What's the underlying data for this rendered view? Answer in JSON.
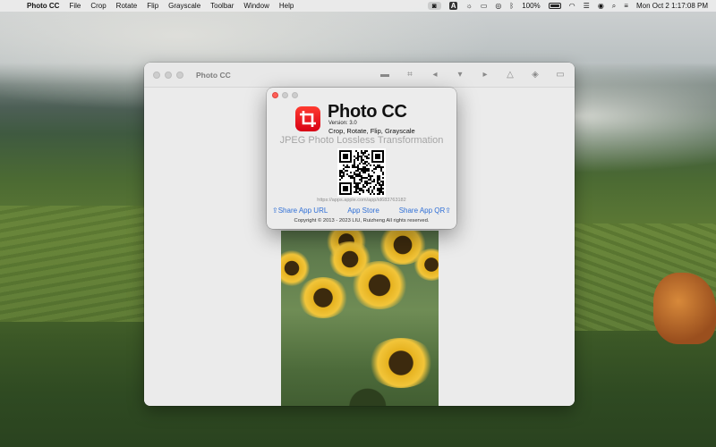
{
  "menubar": {
    "app_menu": "Photo CC",
    "items": [
      "File",
      "Crop",
      "Rotate",
      "Flip",
      "Grayscale",
      "Toolbar",
      "Window",
      "Help"
    ],
    "battery": "100%",
    "datetime": "Mon Oct 2  1:17:08 PM"
  },
  "main_window": {
    "title": "Photo CC",
    "toolbar_icons": [
      "folder-icon",
      "crop-icon",
      "rotate-icon",
      "flip-vertical-icon",
      "flip-horizontal-icon",
      "grayscale-icon",
      "export-icon",
      "panel-icon"
    ]
  },
  "about": {
    "app_name": "Photo CC",
    "version": "Version: 3.0",
    "features": "Crop, Rotate, Flip, Grayscale",
    "tagline": "JPEG Photo Lossless Transformation",
    "url": "https://apps.apple.com/app/id683763182",
    "share_url": "Share App URL",
    "app_store": "App Store",
    "share_qr": "Share App QR",
    "copyright": "Copyright © 2013 - 2023 LIU, Ruizheng All rights reserved."
  }
}
